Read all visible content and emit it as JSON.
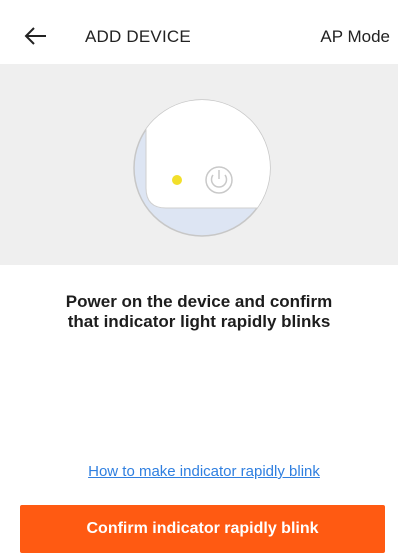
{
  "header": {
    "back_icon": "arrow-left-icon",
    "title": "ADD DEVICE",
    "ap_mode_label": "AP Mode"
  },
  "illustration": {
    "indicator_color": "#f2df2a",
    "power_icon": "power-icon"
  },
  "instruction": {
    "line1": "Power on the device and confirm",
    "line2": "that indicator light rapidly blinks"
  },
  "help_link": "How to make indicator rapidly blink",
  "confirm_button": "Confirm indicator rapidly blink",
  "colors": {
    "accent": "#ff5a12",
    "link": "#2f7fe0",
    "panel_bg": "#efefef"
  }
}
